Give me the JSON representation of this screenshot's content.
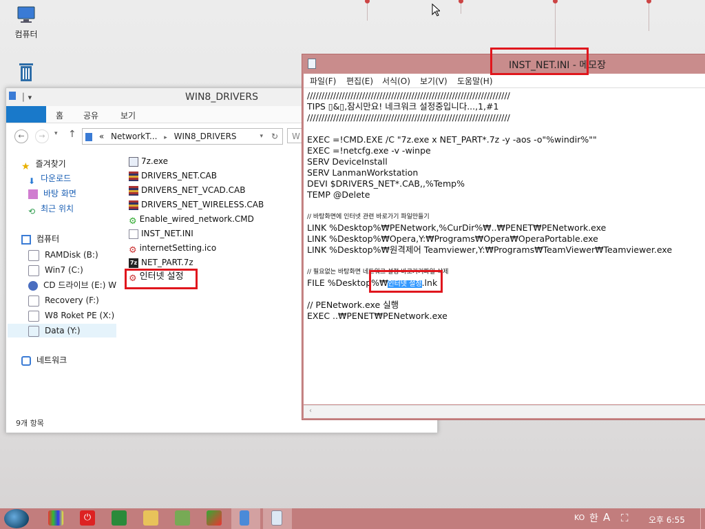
{
  "desktop": {
    "icons": [
      {
        "label": "컴퓨터",
        "icon": "computer-icon"
      },
      {
        "label": "",
        "icon": "recycle-bin-icon"
      }
    ]
  },
  "explorer": {
    "title": "WIN8_DRIVERS",
    "ribbon_tabs": [
      "홈",
      "공유",
      "보기"
    ],
    "address": {
      "segments": [
        "«",
        "NetworkT...",
        "▸",
        "WIN8_DRIVERS"
      ]
    },
    "search_placeholder": "W",
    "nav": {
      "favorites": "즐겨찾기",
      "fav_items": [
        "다운로드",
        "바탕 화면",
        "최근 위치"
      ],
      "computer": "컴퓨터",
      "drives": [
        "RAMDisk (B:)",
        "Win7 (C:)",
        "CD 드라이브 (E:) W",
        "Recovery (F:)",
        "W8 Roket PE (X:)",
        "Data (Y:)"
      ],
      "network": "네트워크"
    },
    "files": [
      "7z.exe",
      "DRIVERS_NET.CAB",
      "DRIVERS_NET_VCAD.CAB",
      "DRIVERS_NET_WIRELESS.CAB",
      "Enable_wired_network.CMD",
      "INST_NET.INI",
      "internetSetting.ico",
      "NET_PART.7z",
      "인터넷 설정"
    ],
    "status": "9개 항목"
  },
  "notepad": {
    "title": "INST_NET.INI - 메모장",
    "menu": [
      "파일(F)",
      "편집(E)",
      "서식(O)",
      "보기(V)",
      "도움말(H)"
    ],
    "lines": [
      "//////////////////////////////////////////////////////////////////////",
      "TIPS ▯&▯,잠시만요! 네크워크 설정중입니다...,1,#1",
      "//////////////////////////////////////////////////////////////////////",
      "",
      "EXEC =!CMD.EXE /C \"7z.exe x NET_PART*.7z -y -aos -o\"%windir%\"\"",
      "EXEC =!netcfg.exe -v -winpe",
      "SERV DeviceInstall",
      "SERV LanmanWorkstation",
      "DEVI $DRIVERS_NET*.CAB,,%Temp%",
      "TEMP @Delete",
      "",
      "// 바탕화면에 인터넷 관련 바로가기 파일만들기",
      "LINK %Desktop%₩PENetwork,%CurDir%₩..₩PENET₩PENetwork.exe",
      "LINK %Desktop%₩Opera,Y:₩Programs₩Opera₩OperaPortable.exe",
      "LINK %Desktop%₩원격제어 Teamviewer,Y:₩Programs₩TeamViewer₩Teamviewer.exe",
      "",
      "// 필요없는 바탕화면 네트워크 설정 바로가기파일 삭제",
      "FILE %Desktop%₩",
      "",
      "// PENetwork.exe 실행",
      "EXEC ..₩PENET₩PENetwork.exe"
    ],
    "highlight_text": "인터넷 설정",
    "highlight_suffix": ".lnk"
  },
  "taskbar": {
    "lang": "KO",
    "ime_mode": "한",
    "ime_char": "A",
    "clock": "오후 6:55"
  }
}
